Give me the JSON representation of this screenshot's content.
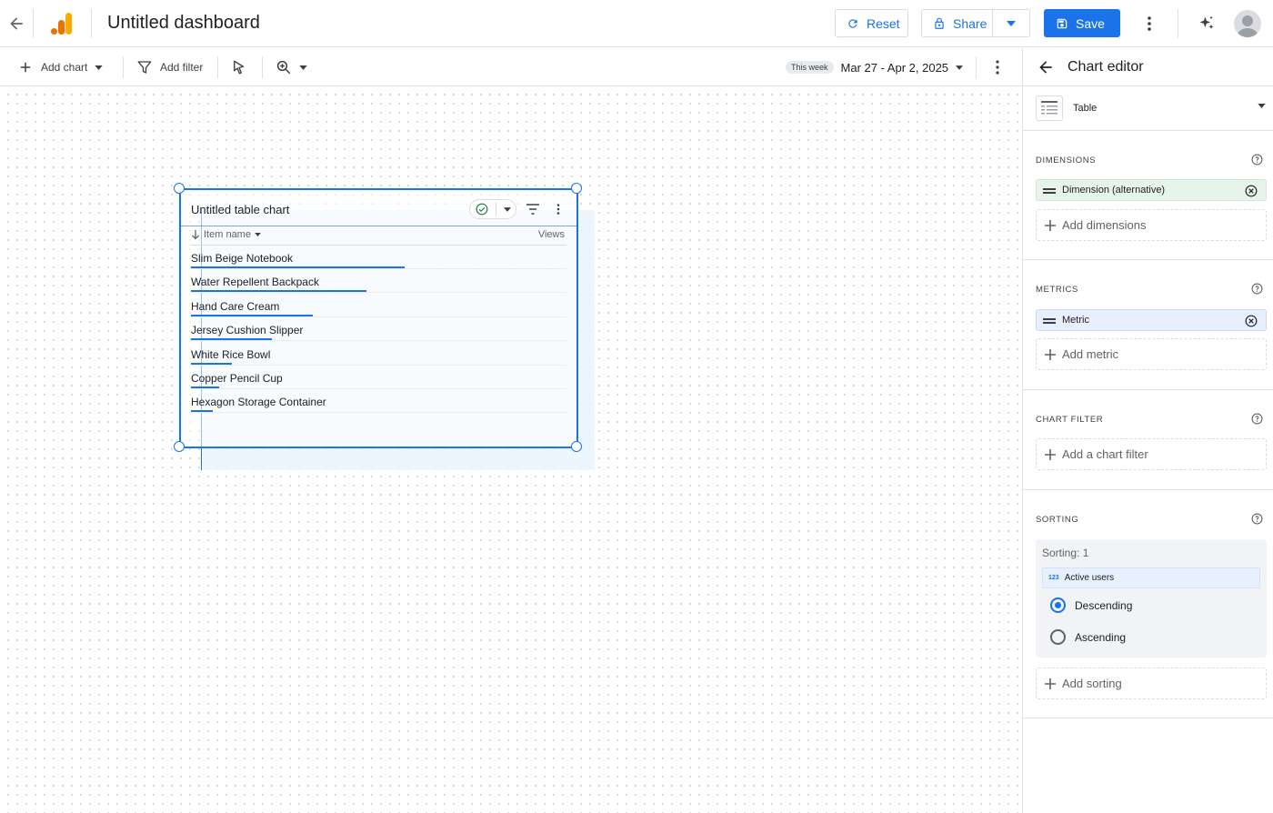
{
  "header": {
    "title": "Untitled dashboard",
    "reset_label": "Reset",
    "share_label": "Share",
    "save_label": "Save"
  },
  "toolbar": {
    "add_chart_label": "Add chart",
    "add_filter_label": "Add filter",
    "date_chip": "This week",
    "date_range": "Mar 27 - Apr 2, 2025"
  },
  "chart": {
    "title": "Untitled table chart",
    "column_item": "Item name",
    "column_views": "Views",
    "rows": [
      {
        "label": "Slim Beige Notebook",
        "bar_fraction": 1.0
      },
      {
        "label": "Water Repellent Backpack",
        "bar_fraction": 0.82
      },
      {
        "label": "Hand Care Cream",
        "bar_fraction": 0.57
      },
      {
        "label": "Jersey Cushion Slipper",
        "bar_fraction": 0.38
      },
      {
        "label": "White Rice Bowl",
        "bar_fraction": 0.19
      },
      {
        "label": "Copper Pencil Cup",
        "bar_fraction": 0.13
      },
      {
        "label": "Hexagon Storage Container",
        "bar_fraction": 0.1
      }
    ]
  },
  "editor": {
    "title": "Chart editor",
    "chart_type": "Table",
    "dimensions": {
      "title": "DIMENSIONS",
      "item": "Dimension (alternative)",
      "add_label": "Add dimensions"
    },
    "metrics": {
      "title": "METRICS",
      "item": "Metric",
      "add_label": "Add metric"
    },
    "chart_filter": {
      "title": "CHART FILTER",
      "add_label": "Add a chart filter"
    },
    "sorting": {
      "title": "SORTING",
      "count": "Sorting: 1",
      "field_badge": "123",
      "field": "Active users",
      "descending": "Descending",
      "ascending": "Ascending",
      "selected": "Descending",
      "add_label": "Add sorting"
    }
  },
  "colors": {
    "accent": "#1a73e8",
    "dimension_pill": "#e6f4ea",
    "metric_pill": "#e8f0fe",
    "logo_orange": "#f9ab00",
    "logo_dark_orange": "#e37400"
  }
}
